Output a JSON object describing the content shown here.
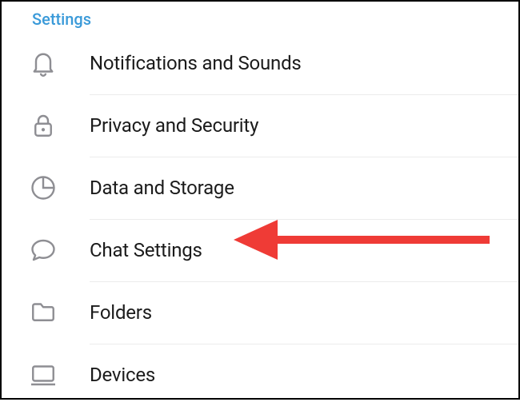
{
  "section_title": "Settings",
  "items": [
    {
      "id": "notifications",
      "icon": "bell-icon",
      "label": "Notifications and Sounds"
    },
    {
      "id": "privacy",
      "icon": "lock-icon",
      "label": "Privacy and Security"
    },
    {
      "id": "data",
      "icon": "pie-icon",
      "label": "Data and Storage"
    },
    {
      "id": "chat",
      "icon": "chat-icon",
      "label": "Chat Settings"
    },
    {
      "id": "folders",
      "icon": "folder-icon",
      "label": "Folders"
    },
    {
      "id": "devices",
      "icon": "devices-icon",
      "label": "Devices"
    }
  ],
  "annotation": {
    "type": "arrow",
    "points_to": "chat",
    "color": "#ef3b36"
  }
}
